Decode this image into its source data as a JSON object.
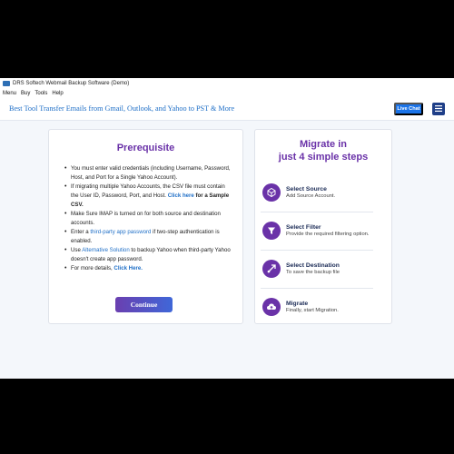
{
  "window": {
    "title": "DRS Softech Webmail Backup Software (Demo)",
    "menu": [
      "Menu",
      "Buy",
      "Tools",
      "Help"
    ]
  },
  "header": {
    "title": "Best Tool Transfer Emails from Gmail, Outlook, and Yahoo to PST & More",
    "live_chat": "Live Chat",
    "menu_icon": "hamburger-icon"
  },
  "prerequisite": {
    "title": "Prerequisite",
    "items": [
      {
        "a": "You must enter valid credentials (including Username, Password, Host, and Port for a Single Yahoo Account)."
      },
      {
        "a": "If migrating multiple Yahoo Accounts, the CSV file must contain the User ID, Password, Port, and Host. ",
        "link": "Click here",
        "b": " for a Sample CSV."
      },
      {
        "a": "Make Sure IMAP is turned on for both source and destination accounts."
      },
      {
        "a": "Enter a ",
        "link": "third-party app password",
        "b": " if two-step authentication is enabled."
      },
      {
        "a": "Use ",
        "link": "Alternative Solution",
        "b": " to backup Yahoo when third-party Yahoo doesn't create app password."
      },
      {
        "a": "For more details, ",
        "link": "Click Here."
      }
    ],
    "continue": "Continue"
  },
  "migrate": {
    "title_line1": "Migrate in",
    "title_line2": "just 4 simple steps",
    "steps": [
      {
        "title": "Select Source",
        "desc": "Add Source Account.",
        "icon": "source-icon"
      },
      {
        "title": "Select Filter",
        "desc": "Provide the required filtering option.",
        "icon": "filter-icon"
      },
      {
        "title": "Select Destination",
        "desc": "To save the backup file",
        "icon": "destination-icon"
      },
      {
        "title": "Migrate",
        "desc": "Finally, start Migration.",
        "icon": "cloud-upload-icon"
      }
    ]
  },
  "colors": {
    "accent": "#6a32a8",
    "link": "#1f6fc7",
    "live_chat": "#1a73e8",
    "menu_button": "#1f3f88"
  }
}
